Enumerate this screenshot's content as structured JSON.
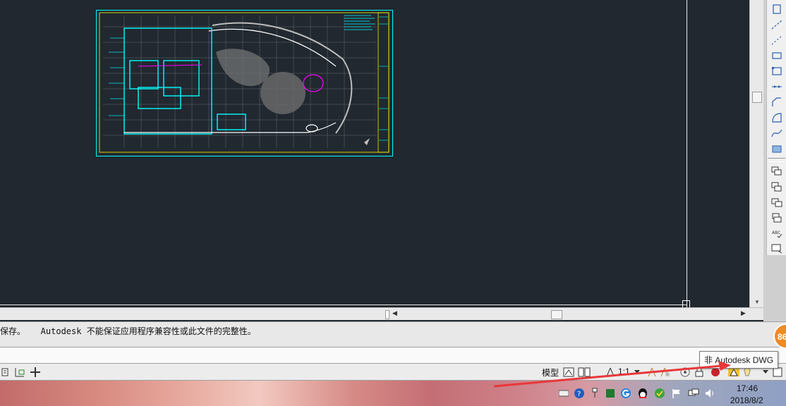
{
  "command_history": {
    "text": "保存。   Autodesk 不能保证应用程序兼容性或此文件的完整性。"
  },
  "status_bar": {
    "model_label": "模型",
    "scale_label": "1:1"
  },
  "tooltip": {
    "text": "非 Autodesk DWG"
  },
  "notification_badge": {
    "value": "86",
    "color": "#f08a24"
  },
  "taskbar": {
    "time": "17:46",
    "date": "2018/8/2"
  },
  "colors": {
    "drawing_background": "#212830",
    "cyan": "#00ffff",
    "magenta": "#ff00ff",
    "yellow": "#ffff00",
    "annotation_red": "#e8373a"
  },
  "toolbar": {
    "icons": [
      "polyline-icon",
      "construction-line-icon",
      "ray-icon",
      "rectangle-icon",
      "polygon-icon",
      "divide-icon",
      "arc-icon",
      "region-icon",
      "spline-icon",
      "hatch-icon",
      "copy-icon",
      "move-icon",
      "rotate-icon",
      "scale-icon",
      "spell-check-icon",
      "block-icon"
    ]
  }
}
